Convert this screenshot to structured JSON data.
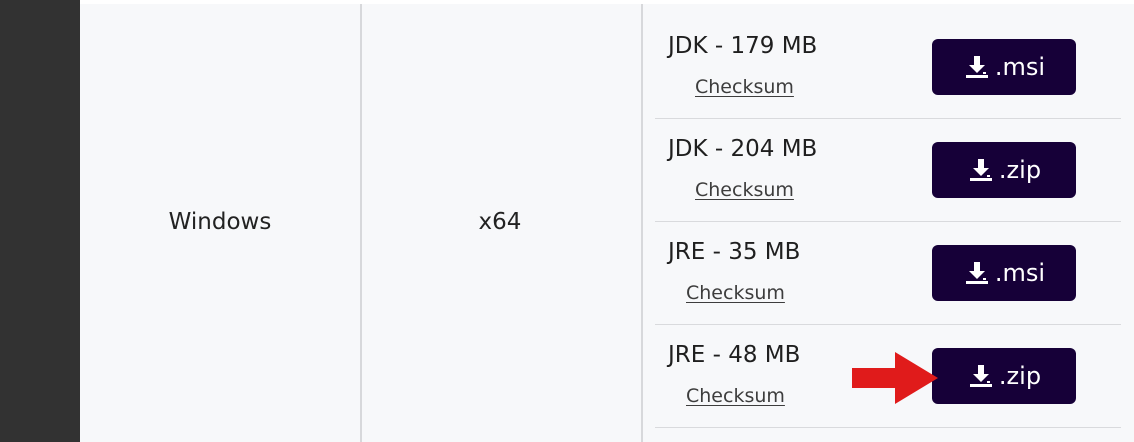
{
  "table": {
    "os": "Windows",
    "arch": "x64",
    "packages": [
      {
        "title": "JDK - 179 MB",
        "checksum": "Checksum",
        "button": ".msi",
        "button_icon": "download-icon"
      },
      {
        "title": "JDK - 204 MB",
        "checksum": "Checksum",
        "button": ".zip",
        "button_icon": "download-icon"
      },
      {
        "title": "JRE - 35 MB",
        "checksum": "Checksum",
        "button": ".msi",
        "button_icon": "download-icon"
      },
      {
        "title": "JRE - 48 MB",
        "checksum": "Checksum",
        "button": ".zip",
        "button_icon": "download-icon"
      }
    ]
  },
  "colors": {
    "button_bg": "#160038",
    "page_bg": "#f7f8fa",
    "left_bar": "#323232",
    "annotation_arrow": "#e01b1b"
  },
  "annotation": {
    "icon": "red-arrow-right",
    "target": "jre-48mb-zip-download-button"
  }
}
